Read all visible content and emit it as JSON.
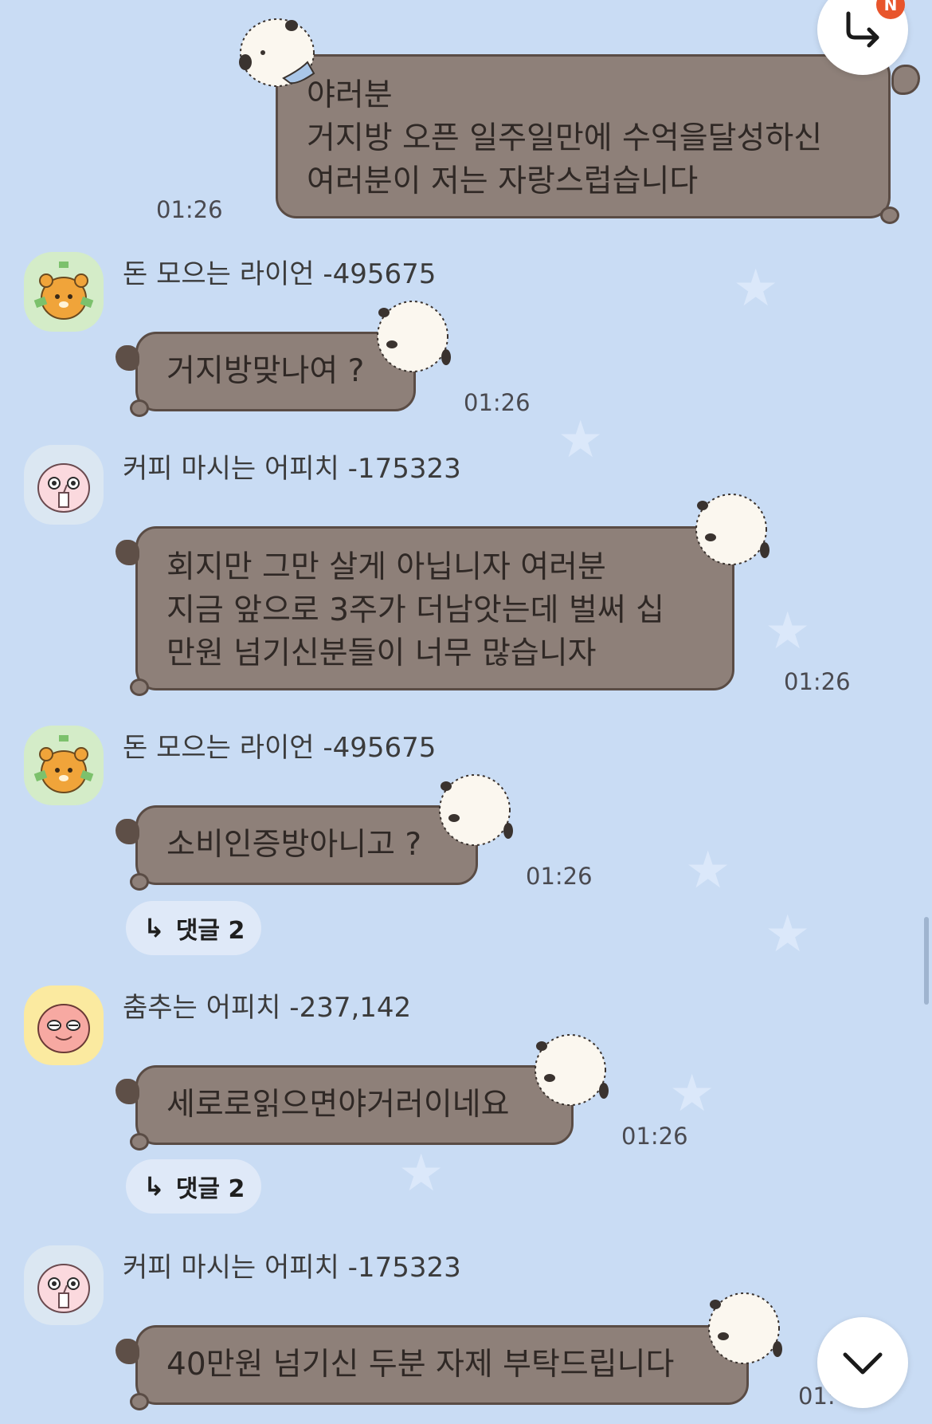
{
  "messages": [
    {
      "sender": "me",
      "lines": [
        "야러분",
        "거지방 오픈 일주일만에 수억을달성하신",
        "여러분이 저는 자랑스럽습니다"
      ],
      "time": "01:26"
    },
    {
      "sender": "돈 모으는 라이언 -495675",
      "avatar": "ryan-money-avatar",
      "lines": [
        "거지방맞나여 ?"
      ],
      "time": "01:26"
    },
    {
      "sender": "커피 마시는 어피치 -175323",
      "avatar": "apeach-coffee-avatar",
      "lines": [
        "회지만 그만 살게 아닙니자 여러분",
        "지금 앞으로 3주가 더남앗는데 벌써 십",
        "만원 넘기신분들이 너무 많습니자"
      ],
      "time": "01:26"
    },
    {
      "sender": "돈 모으는 라이언 -495675",
      "avatar": "ryan-money-avatar",
      "lines": [
        "소비인증방아니고 ?"
      ],
      "time": "01:26",
      "reply": "댓글 2"
    },
    {
      "sender": "춤추는 어피치 -237,142",
      "avatar": "apeach-dance-avatar",
      "lines": [
        "세로로읽으면야거러이네요"
      ],
      "time": "01:26",
      "reply": "댓글 2"
    },
    {
      "sender": "커피 마시는 어피치 -175323",
      "avatar": "apeach-coffee-avatar",
      "lines": [
        "40만원 넘기신 두분 자제 부탁드립니다"
      ],
      "time": "01:"
    }
  ],
  "icons": {
    "reply_icon": "↳",
    "fab_top_icon": "reply-arrow-icon",
    "fab_bottom_icon": "chevron-down-icon"
  },
  "badge": "N",
  "colors": {
    "background": "#c9dcf4",
    "bubble": "#8e8079",
    "bubble_border": "#5a4c45",
    "badge": "#e8552c"
  }
}
